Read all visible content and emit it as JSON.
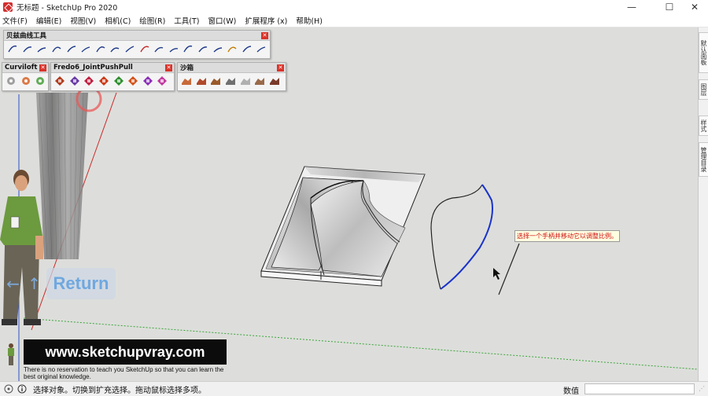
{
  "window": {
    "title": "无标题 - SketchUp Pro 2020",
    "controls": {
      "minimize": "—",
      "maximize": "☐",
      "close": "✕"
    }
  },
  "menu": [
    "文件(F)",
    "编辑(E)",
    "视图(V)",
    "相机(C)",
    "绘图(R)",
    "工具(T)",
    "窗口(W)",
    "扩展程序 (x)",
    "帮助(H)"
  ],
  "toolbars": {
    "bezier": {
      "title": "贝兹曲线工具",
      "tool_count": 18
    },
    "curviloft": {
      "title": "Curviloft",
      "tool_count": 3
    },
    "fredo": {
      "title": "Fredo6_JointPushPull",
      "tool_count": 8
    },
    "sandbox": {
      "title": "沙箱",
      "tool_count": 7
    }
  },
  "tray_tabs": [
    "默认面板",
    "图层",
    "样式",
    "管理目录"
  ],
  "overlay": {
    "return_label": "Return",
    "nav_left": "←",
    "nav_right": "↑"
  },
  "watermark": {
    "site": "www.sketchupvray.com",
    "caption": "There is no reservation to teach you SketchUp so that you can learn the best original knowledge."
  },
  "tooltip": "选择一个手柄并移动它以调整比例。",
  "status": {
    "text": "选择对象。切换到扩充选择。拖动鼠标选择多项。",
    "measure_label": "数值",
    "measure_value": ""
  },
  "colors": {
    "viewport": "#dddedb",
    "selected_curve": "#1a33cc",
    "close_button": "#d9342b",
    "tooltip_text": "#d01010"
  }
}
